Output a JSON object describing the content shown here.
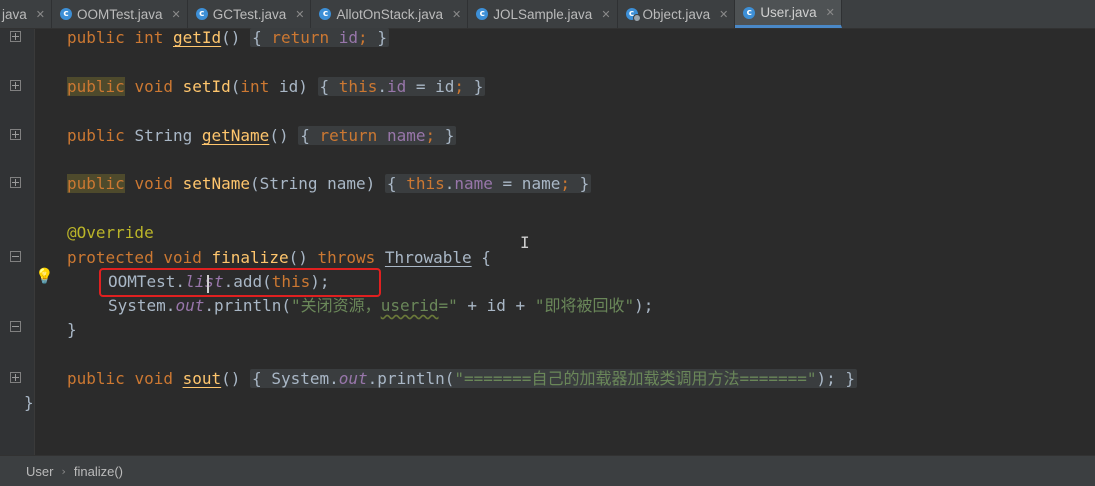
{
  "tabs": [
    {
      "label": "java",
      "active": false,
      "partial": true
    },
    {
      "label": "OOMTest.java",
      "active": false
    },
    {
      "label": "GCTest.java",
      "active": false
    },
    {
      "label": "AllotOnStack.java",
      "active": false
    },
    {
      "label": "JOLSample.java",
      "active": false
    },
    {
      "label": "Object.java",
      "active": false
    },
    {
      "label": "User.java",
      "active": true
    }
  ],
  "code": {
    "getid": {
      "kw1": "public",
      "kw2": "int",
      "name": "getId",
      "paren": "()",
      "open": "{",
      "ret": "return",
      "field": "id",
      "semi": ";",
      "close": "}"
    },
    "setid": {
      "kw1": "public",
      "kw2": "void",
      "name": "setId",
      "params_open": "(",
      "ptype": "int",
      "pname": "id",
      "params_close": ")",
      "open": "{",
      "this": "this",
      "field": "id",
      "assign": " = id",
      "semi": ";",
      "close": "}"
    },
    "getname": {
      "kw1": "public",
      "type": "String",
      "name": "getName",
      "paren": "()",
      "open": "{",
      "ret": "return",
      "field": "name",
      "semi": ";",
      "close": "}"
    },
    "setname": {
      "kw1": "public",
      "kw2": "void",
      "name": "setName",
      "params": "(String name)",
      "open": "{",
      "this": "this",
      "field": "name",
      "assign": " = name",
      "semi": ";",
      "close": "}"
    },
    "override": "@Override",
    "finalize": {
      "kw1": "protected",
      "kw2": "void",
      "name": "finalize",
      "paren": "()",
      "throws": "throws",
      "exc": "Throwable",
      "open": "{"
    },
    "line1": {
      "cls": "OOMTest.",
      "field": "list",
      "rest": ".add(",
      "this": "this",
      "end": ");"
    },
    "line2": {
      "cls": "System.",
      "field": "out",
      "call": ".println(",
      "s1": "\"关闭资源，",
      "s1u": "userid",
      "s1e": "=\"",
      "mid": " + id + ",
      "s2": "\"即将被回收\"",
      "end": ");"
    },
    "close_method": "}",
    "sout": {
      "kw1": "public",
      "kw2": "void",
      "name": "sout",
      "paren": "()",
      "open": "{",
      "cls": "System.",
      "field": "out",
      "call": ".println(",
      "s": "\"=======自己的加载器加载类调用方法=======\"",
      "end": ");",
      "close": "}"
    },
    "close_class": "}"
  },
  "breadcrumb": {
    "class": "User",
    "sep": "›",
    "method": "finalize()"
  },
  "colors": {
    "keyword": "#cc7832",
    "method": "#ffc66d",
    "field": "#9876aa",
    "string": "#6a8759",
    "annotation": "#bbb529",
    "text": "#a9b7c6",
    "highlight_box": "#e02020",
    "active_tab_border": "#4a88c7"
  }
}
